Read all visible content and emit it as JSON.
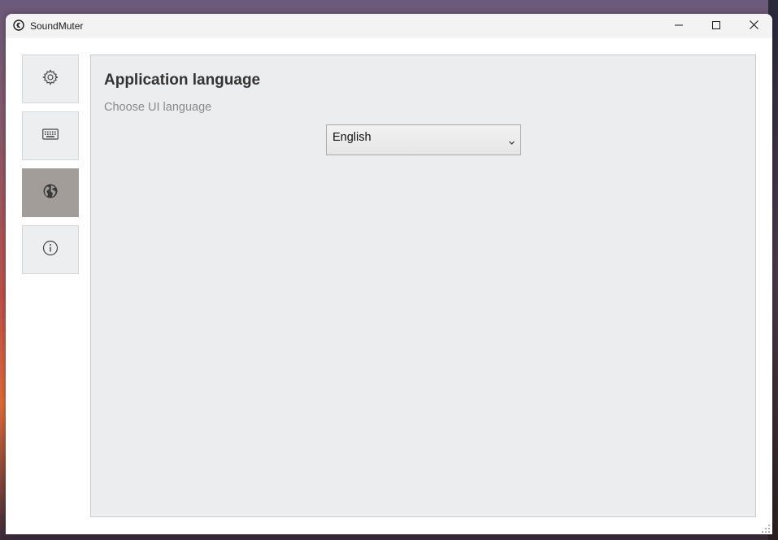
{
  "window": {
    "title": "SoundMuter",
    "icon": "app-logo-icon",
    "controls": [
      "minimize-icon",
      "maximize-icon",
      "close-icon"
    ]
  },
  "sidebar": {
    "items": [
      {
        "id": "settings",
        "icon": "gear-icon",
        "active": false
      },
      {
        "id": "hotkeys",
        "icon": "keyboard-icon",
        "active": false
      },
      {
        "id": "language",
        "icon": "globe-icon",
        "active": true
      },
      {
        "id": "about",
        "icon": "info-icon",
        "active": false
      }
    ]
  },
  "main": {
    "title": "Application language",
    "subtitle": "Choose UI language",
    "language_select": {
      "value": "English",
      "icon": "chevron-down-icon"
    }
  },
  "colors": {
    "titlebar": "#f3f3f3",
    "content_bg": "#ecedef",
    "sidebar_active": "#a29d98",
    "heading": "#333333",
    "subtitle": "#8a8a8a"
  }
}
